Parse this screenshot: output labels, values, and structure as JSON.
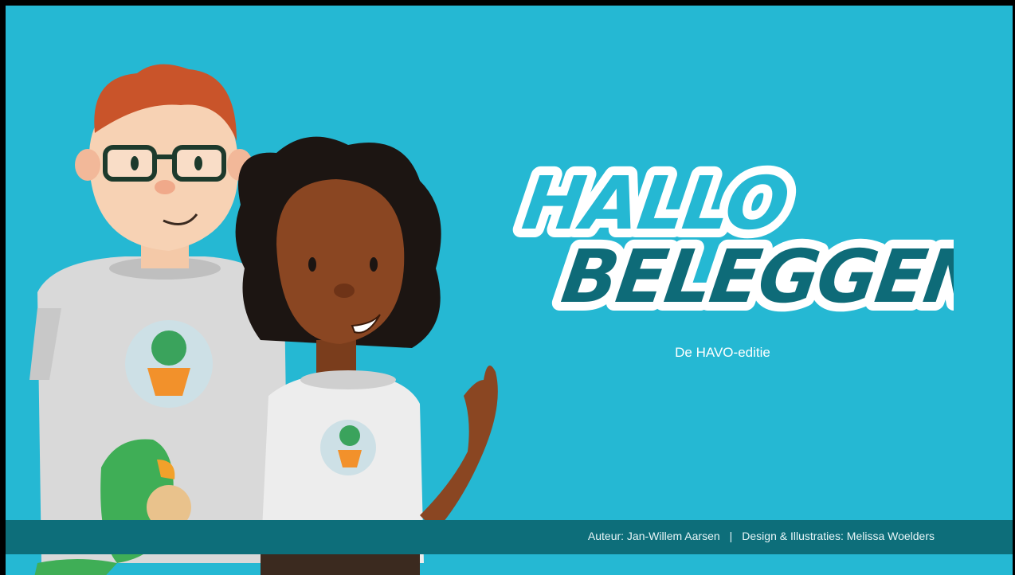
{
  "logo": {
    "line1": "HALLO",
    "line2": "BELEGGEN",
    "line1_color": "#25b8d3",
    "line2_color": "#0e6b78",
    "outline_color": "#ffffff"
  },
  "subtitle": "De HAVO-editie",
  "credits": {
    "author": "Auteur: Jan-Willem Aarsen",
    "separator": "|",
    "design": "Design & Illustraties: Melissa Woelders"
  },
  "colors": {
    "background": "#25b8d3",
    "footer_bar": "#0d6e7a"
  }
}
